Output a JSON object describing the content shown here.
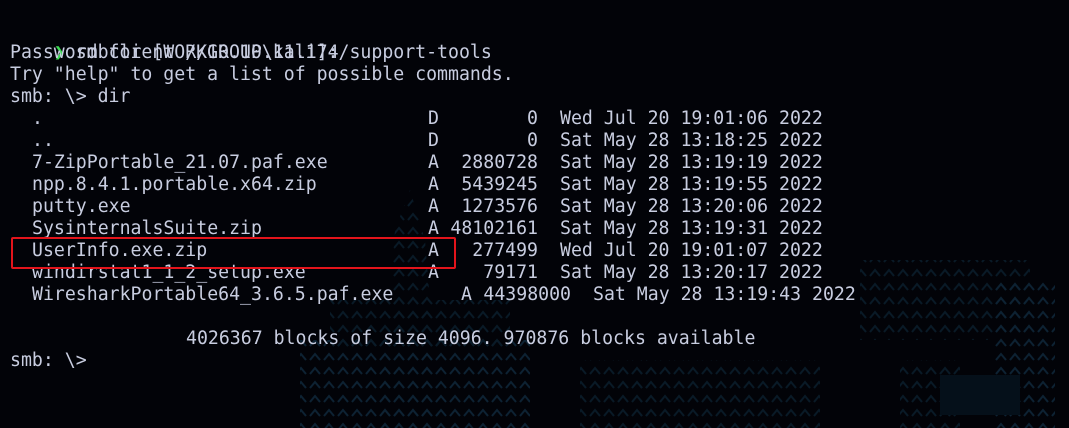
{
  "terminal": {
    "prompt_symbol": "❯",
    "command": "smbclient //10.10.11.174/support-tools",
    "password_line": "Password for [WORKGROUP\\kali]:",
    "help_line": "Try \"help\" to get a list of possible commands.",
    "smb_prompt_dir": "smb: \\> dir",
    "listing": [
      {
        "name": ".",
        "attr": "D",
        "size": "0",
        "date": "Wed Jul 20 19:01:06 2022"
      },
      {
        "name": "..",
        "attr": "D",
        "size": "0",
        "date": "Sat May 28 13:18:25 2022"
      },
      {
        "name": "7-ZipPortable_21.07.paf.exe",
        "attr": "A",
        "size": "2880728",
        "date": "Sat May 28 13:19:19 2022"
      },
      {
        "name": "npp.8.4.1.portable.x64.zip",
        "attr": "A",
        "size": "5439245",
        "date": "Sat May 28 13:19:55 2022"
      },
      {
        "name": "putty.exe",
        "attr": "A",
        "size": "1273576",
        "date": "Sat May 28 13:20:06 2022"
      },
      {
        "name": "SysinternalsSuite.zip",
        "attr": "A",
        "size": "48102161",
        "date": "Sat May 28 13:19:31 2022"
      },
      {
        "name": "UserInfo.exe.zip",
        "attr": "A",
        "size": "277499",
        "date": "Wed Jul 20 19:01:07 2022"
      },
      {
        "name": "windirstat1_1_2_setup.exe",
        "attr": "A",
        "size": "79171",
        "date": "Sat May 28 13:20:17 2022"
      },
      {
        "name": "WiresharkPortable64_3.6.5.paf.exe",
        "attr": "A",
        "size": "44398000",
        "date": "Sat May 28 13:19:43 2022"
      }
    ],
    "blocks_line": "4026367 blocks of size 4096. 970876 blocks available",
    "smb_prompt_final": "smb: \\>"
  },
  "colors": {
    "background": "#020308",
    "text": "#c8cde0",
    "prompt_arrow": "#3ddc54",
    "highlight_border": "#e3141b"
  }
}
